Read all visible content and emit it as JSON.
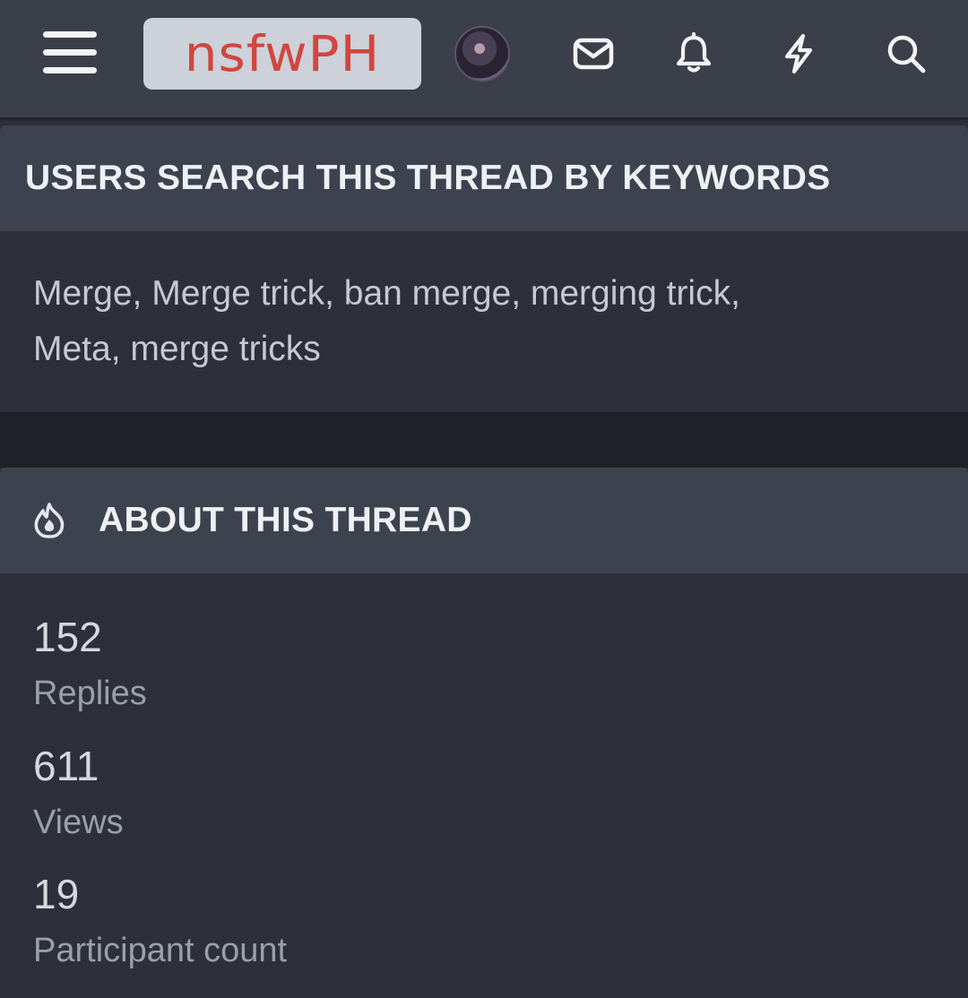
{
  "header": {
    "logo_text": "nsfwPH",
    "icons": [
      "menu-icon",
      "avatar",
      "envelope-icon",
      "bell-icon",
      "lightning-icon",
      "search-icon"
    ]
  },
  "keywords_panel": {
    "title": "USERS SEARCH THIS THREAD BY KEYWORDS",
    "line1": "Merge, Merge trick, ban merge, merging trick,",
    "line2": "Meta, merge tricks"
  },
  "about_panel": {
    "title": "ABOUT THIS THREAD",
    "icon": "fire-icon",
    "stats": [
      {
        "value": "152",
        "label": "Replies"
      },
      {
        "value": "611",
        "label": "Views"
      },
      {
        "value": "19",
        "label": "Participant count"
      }
    ]
  },
  "colors": {
    "topbar": "#3a3f49",
    "panel_header": "#3c434e",
    "panel_body": "#2d303b",
    "logo_bg": "#cdd1d9",
    "logo_text": "#d1463f"
  }
}
